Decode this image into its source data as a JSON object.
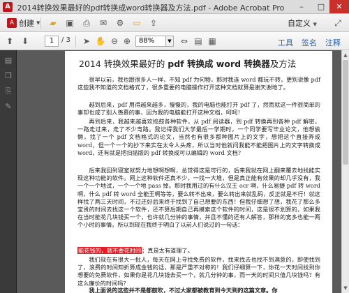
{
  "window": {
    "title": "2014转换效果最好的pdf转换成word转换器及方法.pdf - Adobe Acrobat Pro",
    "app_icon": "A",
    "minimize": "–",
    "maximize": "□",
    "close": "✕"
  },
  "toolbar1": {
    "create_label": "创建",
    "create_icon": "A",
    "customize_label": "自定义",
    "icons": [
      "open-folder-icon",
      "save-icon",
      "print-icon",
      "email-icon",
      "gear-icon",
      "comment-icon",
      "share-icon"
    ]
  },
  "toolbar2": {
    "page_current": "1",
    "page_total": "/ 3",
    "zoom_value": "88%",
    "zoom_dropdown": "▼",
    "tabs": [
      "工具",
      "签名",
      "注释"
    ]
  },
  "document": {
    "title_prefix": "2014 转换效果最好的 ",
    "title_bold": "pdf 转换成 word 转换器",
    "title_suffix": "及方法",
    "paragraphs": [
      "很早以前，我也跟很多人一样，不知 pdf 为何物，那时我连 word 都玩不转，更别说像 pdf 这些我不知道的文档格式了，很多重要的电脑操作打开这种文档就算是谢天谢地了。",
      "越到后来，pdf 用得越来越多，慢慢的，我的电脑也能打开 pdf 了，然而就这一件很简单的事却也成了别人羡慕的事，因为我的电脑能打开这种文档，呵呵！",
      "再到后来，我越来越喜欢捣鼓各种软件，从 pdf 阅读器，到 pdf 转换再到各种 pdf 解密，一路走过来，走了不少弯路。我记得我们大学最后一学期时，一个同学要写毕业论文，他想偷懒，找了一个 pdf 文档格式的论文，当然也有很多都种图片上的文字，想把这个直接弄成 word，但一个一个的抄下来实在太令人头疼，所以当时他就问我能不能把图片上的文字转换成 word，还有就是把扫描版的 pdf 转换成可以编辑的 word 文档？",
      "后来我回到寝室就努力地想啊想啊，总觉得这是可行的，后来我就在网上翻来覆去地找能实现这种功能的软件。网上这种软件还真不少，一找一大堆，但是真正能有效果的却几乎没有，我一个一个地试，一个一个地 pass 掉。那时我用过的有什么汉王 ocr 啊，什么易捷 pdf 转 word 啊，什么 pdf 转 word 全能王啊等等，要么转不出来，要么转出来就乱码，反正就是不行！就这样找了两三天时间，不过还好后来终于找到了自己想要的东西！但我仔细想了想，我花了那么多宝贵的时间去找这一个软件，还不算后期自己再摸索这个软件的时间，这是很不划算的，如果我在当时能花几块钱买一个，也许就几分钟的事情，并且不懂的还有人解答，那样的宽多也能一两个小时的事情。所以到现在我终于明白了以前人们说过的一句话：",
      "；真是太有道理了。",
      "我们现在有很大一批人，每天在网上寻找免费的软件，找来找去也找不到满意的，即使找到了，浪费的时间知折算成金钱的话，那是严重不对称的！我们仔细算一下，你花一天时间找到你想要的免费软件，如果你是花几块钱去买一个，就几分钟的事，而一天的时间只值几块钱吗？有这么廉价的时间吗？",
      "我上面说的这些并不是都鼓吹，不过大家都被教育到今天到的这篇文章。你"
    ],
    "highlight": "能花钱的，就不要花时间"
  }
}
